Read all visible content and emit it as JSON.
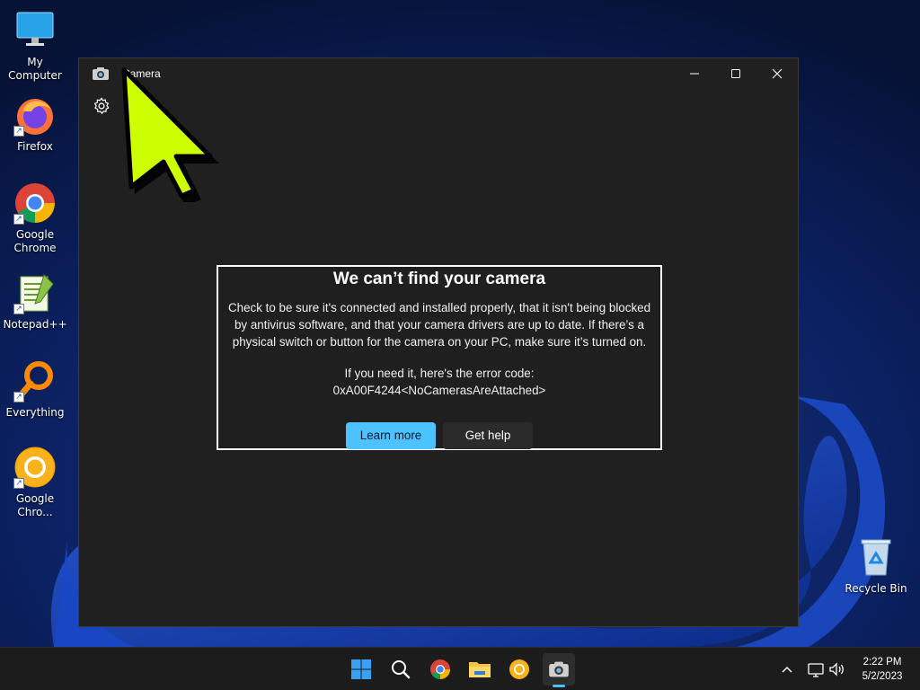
{
  "desktop": {
    "icons": [
      {
        "label": "My Computer",
        "icon": "monitor-icon"
      },
      {
        "label": "Firefox",
        "icon": "firefox-icon"
      },
      {
        "label": "Google Chrome",
        "icon": "chrome-icon"
      },
      {
        "label": "Notepad++",
        "icon": "notepadpp-icon"
      },
      {
        "label": "Everything",
        "icon": "everything-search-icon"
      },
      {
        "label": "Google Chro...",
        "icon": "chrome-canary-icon"
      },
      {
        "label": "Recycle Bin",
        "icon": "recycle-bin-icon"
      }
    ]
  },
  "window": {
    "title": "Camera",
    "icon": "camera-icon",
    "controls": [
      "minimize-icon",
      "maximize-icon",
      "close-icon"
    ],
    "settings_icon": "gear-icon"
  },
  "error": {
    "title": "We can’t find your camera",
    "body_line1": "Check to be sure it's connected and installed properly, that it isn't being blocked",
    "body_line2": "by antivirus software, and that your camera drivers are up to date. If there’s a",
    "body_line3": "physical switch or button for the camera on your PC, make sure it’s turned on.",
    "code_label": "If you need it, here's the error code:",
    "code": "0xA00F4244<NoCamerasAreAttached>",
    "learn_more": "Learn more",
    "get_help": "Get help"
  },
  "taskbar": {
    "apps": [
      "windows-start-icon",
      "search-icon",
      "chrome-icon",
      "file-explorer-icon",
      "chrome-canary-icon",
      "camera-icon"
    ],
    "tray": [
      "chevron-up-icon",
      "network-icon",
      "volume-icon"
    ],
    "time": "2:22 PM",
    "date": "5/2/2023"
  },
  "colors": {
    "accent": "#4cc2ff",
    "window_bg": "#202020",
    "taskbar_bg": "#1c1c1c",
    "pointer": "#ccff00"
  }
}
